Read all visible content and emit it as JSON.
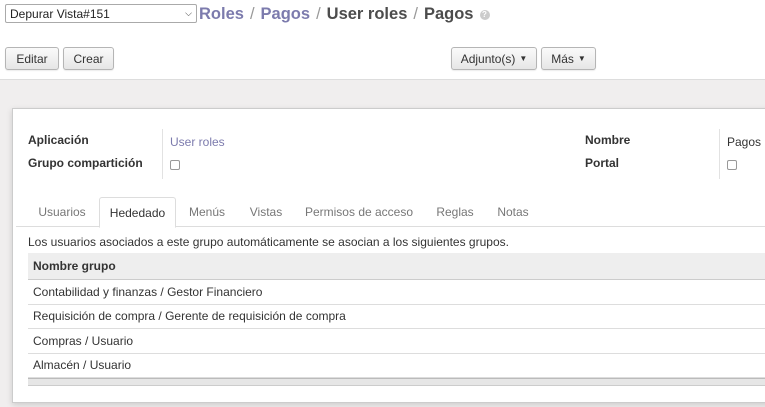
{
  "debug": {
    "selected": "Depurar Vista#151"
  },
  "breadcrumb": {
    "item1": "Roles",
    "item2": "Pagos",
    "item3": "User roles",
    "current": "Pagos",
    "separator": "/",
    "help": "?"
  },
  "toolbar": {
    "edit_label": "Editar",
    "create_label": "Crear",
    "attach_label": "Adjunto(s)",
    "more_label": "Más"
  },
  "form": {
    "application_label": "Aplicación",
    "application_value": "User roles",
    "share_group_label": "Grupo compartición",
    "name_label": "Nombre",
    "name_value": "Pagos",
    "portal_label": "Portal"
  },
  "tabs": [
    {
      "label": "Usuarios"
    },
    {
      "label": "Hededado"
    },
    {
      "label": "Menús"
    },
    {
      "label": "Vistas"
    },
    {
      "label": "Permisos de acceso"
    },
    {
      "label": "Reglas"
    },
    {
      "label": "Notas"
    }
  ],
  "inherited": {
    "description": "Los usuarios asociados a este grupo automáticamente se asocian a los siguientes grupos.",
    "column_header": "Nombre grupo",
    "rows": [
      "Contabilidad y finanzas / Gestor Financiero",
      "Requisición de compra / Gerente de requisición de compra",
      "Compras / Usuario",
      "Almacén / Usuario"
    ]
  }
}
